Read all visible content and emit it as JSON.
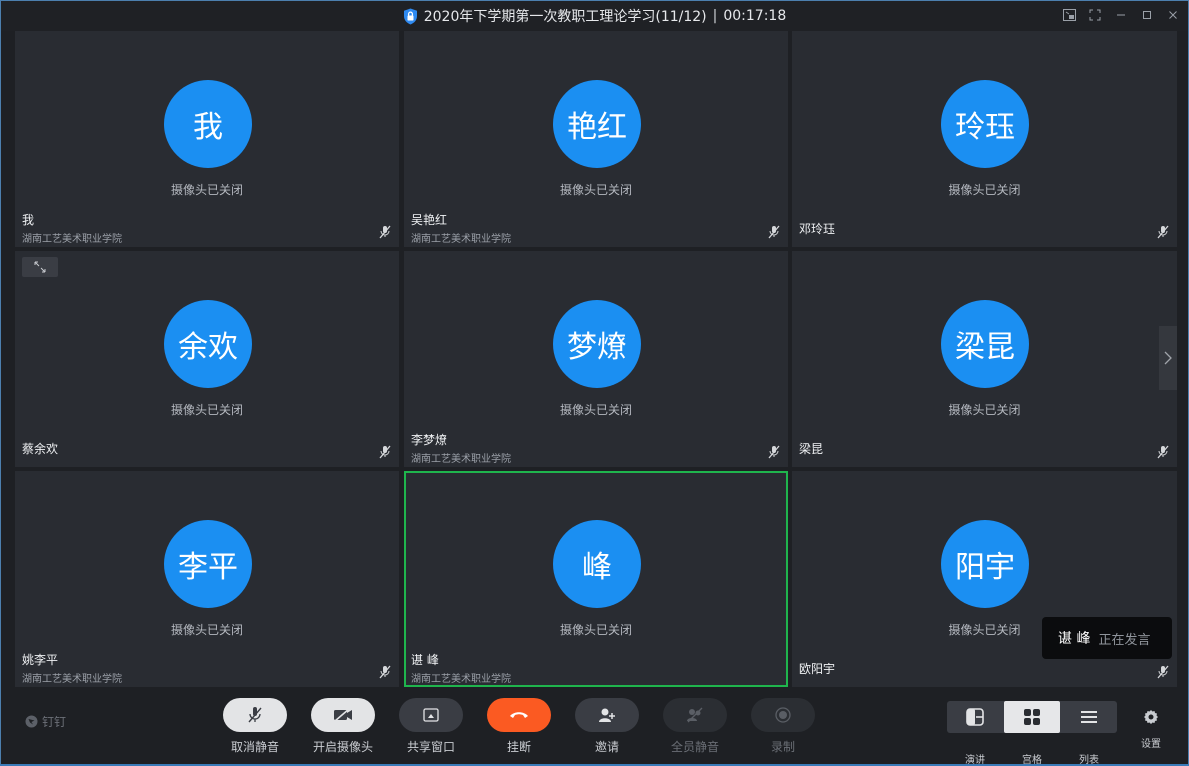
{
  "window": {
    "title": "2020年下学期第一次教职工理论学习(11/12)",
    "separator": "|",
    "timer": "00:17:18"
  },
  "camera_off_text": "摄像头已关闭",
  "participants": [
    {
      "avatar": "我",
      "name": "我",
      "org": "湖南工艺美术职业学院"
    },
    {
      "avatar": "艳红",
      "name": "吴艳红",
      "org": "湖南工艺美术职业学院"
    },
    {
      "avatar": "玲珏",
      "name": "邓玲珏",
      "org": ""
    },
    {
      "avatar": "余欢",
      "name": "蔡余欢",
      "org": ""
    },
    {
      "avatar": "梦燎",
      "name": "李梦燎",
      "org": "湖南工艺美术职业学院"
    },
    {
      "avatar": "梁昆",
      "name": "梁昆",
      "org": ""
    },
    {
      "avatar": "李平",
      "name": "姚李平",
      "org": "湖南工艺美术职业学院"
    },
    {
      "avatar": "峰",
      "name": "谌 峰",
      "org": "湖南工艺美术职业学院"
    },
    {
      "avatar": "阳宇",
      "name": "欧阳宇",
      "org": ""
    }
  ],
  "speaking": {
    "name": "谌 峰",
    "status": "正在发言"
  },
  "brand": "钉钉",
  "toolbar": {
    "mute": "取消静音",
    "camera": "开启摄像头",
    "share": "共享窗口",
    "hangup": "挂断",
    "invite": "邀请",
    "mute_all": "全员静音",
    "record": "录制"
  },
  "views": {
    "present": "演讲",
    "grid": "宫格",
    "list": "列表"
  },
  "settings": "设置",
  "colors": {
    "avatar": "#1b8ff2",
    "hangup": "#fb5a22",
    "active_border": "#1fb54d"
  }
}
